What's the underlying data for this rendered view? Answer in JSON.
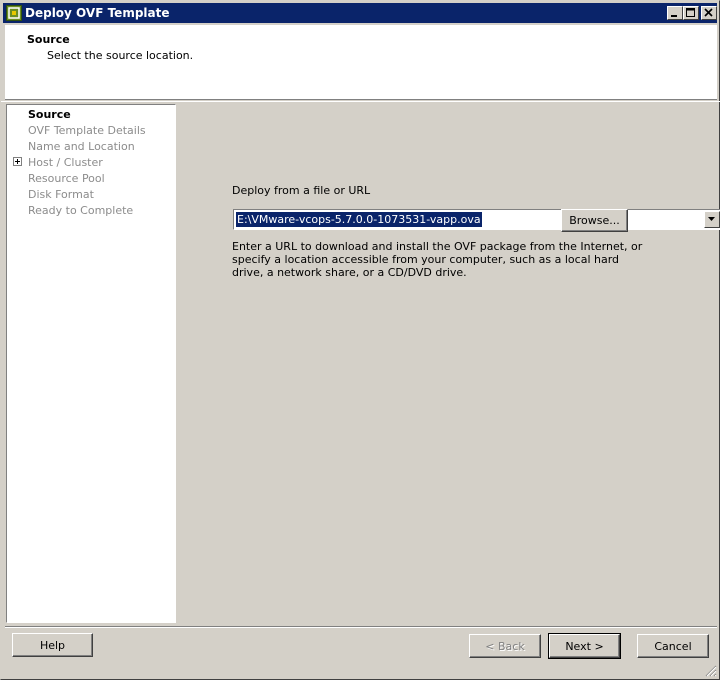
{
  "window": {
    "title": "Deploy OVF Template"
  },
  "header": {
    "title": "Source",
    "subtitle": "Select the source location."
  },
  "nav": {
    "items": [
      {
        "label": "Source",
        "active": true
      },
      {
        "label": "OVF Template Details",
        "active": false
      },
      {
        "label": "Name and Location",
        "active": false
      },
      {
        "label": "Host / Cluster",
        "active": false,
        "expandable": true
      },
      {
        "label": "Resource Pool",
        "active": false
      },
      {
        "label": "Disk Format",
        "active": false
      },
      {
        "label": "Ready to Complete",
        "active": false
      }
    ]
  },
  "main": {
    "deploy_label": "Deploy from a file or URL",
    "source_value": "E:\\VMware-vcops-5.7.0.0-1073531-vapp.ova",
    "browse_label": "Browse...",
    "help_text": "Enter a URL to download and install the OVF package from the Internet, or specify a location accessible from your computer, such as a local hard drive, a network share, or a CD/DVD drive."
  },
  "footer": {
    "help_label": "Help",
    "back_label": "< Back",
    "next_label": "Next >",
    "cancel_label": "Cancel"
  },
  "colors": {
    "titlebar": "#0a246a",
    "window_face": "#d4d0c8",
    "disabled_text": "#8c8c8c",
    "selection": "#0a246a"
  }
}
